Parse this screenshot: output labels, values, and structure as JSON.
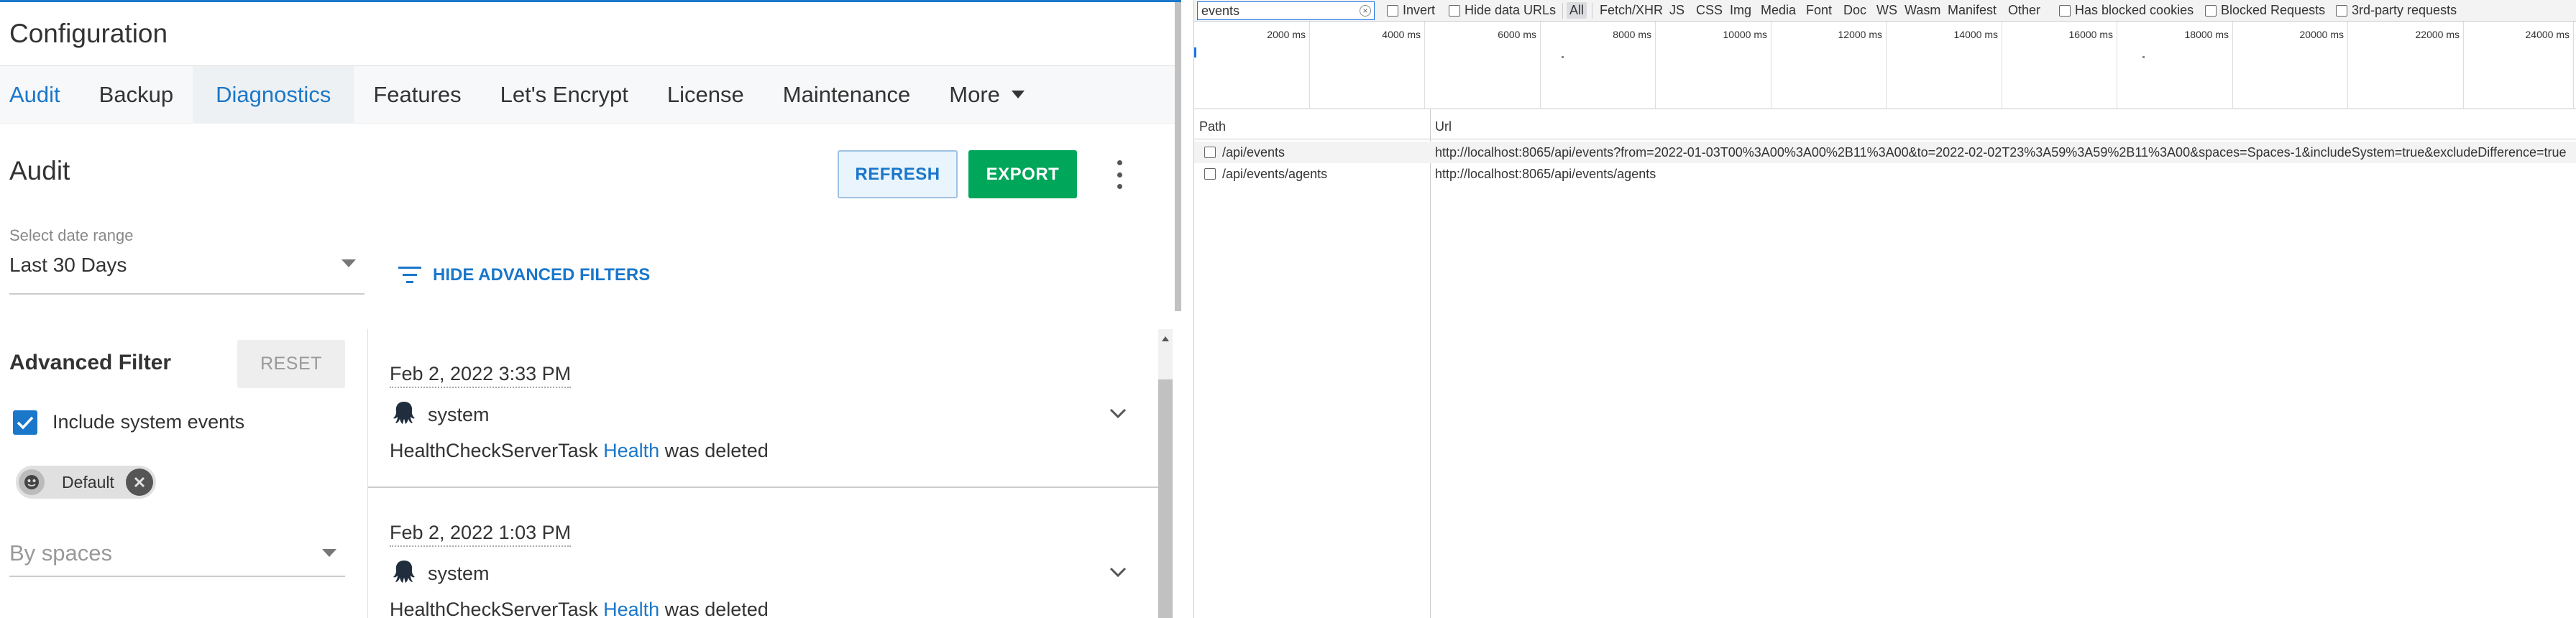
{
  "app": {
    "title": "Configuration",
    "tabs": [
      "Audit",
      "Backup",
      "Diagnostics",
      "Features",
      "Let's Encrypt",
      "License",
      "Maintenance",
      "More"
    ],
    "section_title": "Audit",
    "refresh_label": "REFRESH",
    "export_label": "EXPORT",
    "date_range": {
      "label": "Select date range",
      "value": "Last 30 Days"
    },
    "hide_filters_label": "HIDE ADVANCED FILTERS",
    "advanced_filter": {
      "title": "Advanced Filter",
      "reset_label": "RESET",
      "include_system_label": "Include system events",
      "include_system_checked": true,
      "chip_label": "Default",
      "spaces_placeholder": "By spaces"
    },
    "events": [
      {
        "time": "Feb 2, 2022 3:33 PM",
        "user": "system",
        "desc_prefix": "HealthCheckServerTask ",
        "link": "Health",
        "desc_suffix": " was deleted"
      },
      {
        "time": "Feb 2, 2022 1:03 PM",
        "user": "system",
        "desc_prefix": "HealthCheckServerTask ",
        "link": "Health",
        "desc_suffix": " was deleted"
      }
    ],
    "colors": {
      "accent": "#1a77ca",
      "export_green": "#00a65a"
    }
  },
  "devtools": {
    "filter_value": "events",
    "options": [
      "Invert",
      "Hide data URLs"
    ],
    "types": [
      "All",
      "Fetch/XHR",
      "JS",
      "CSS",
      "Img",
      "Media",
      "Font",
      "Doc",
      "WS",
      "Wasm",
      "Manifest",
      "Other"
    ],
    "active_type": "All",
    "extra_options": [
      "Has blocked cookies",
      "Blocked Requests",
      "3rd-party requests"
    ],
    "timeline_ticks": [
      "2000 ms",
      "4000 ms",
      "6000 ms",
      "8000 ms",
      "10000 ms",
      "12000 ms",
      "14000 ms",
      "16000 ms",
      "18000 ms",
      "20000 ms",
      "22000 ms",
      "24000 ms"
    ],
    "columns": [
      "Path",
      "Url"
    ],
    "requests": [
      {
        "path": "/api/events",
        "url": "http://localhost:8065/api/events?from=2022-01-03T00%3A00%3A00%2B11%3A00&to=2022-02-02T23%3A59%3A59%2B11%3A00&spaces=Spaces-1&includeSystem=true&excludeDifference=true"
      },
      {
        "path": "/api/events/agents",
        "url": "http://localhost:8065/api/events/agents"
      }
    ]
  }
}
